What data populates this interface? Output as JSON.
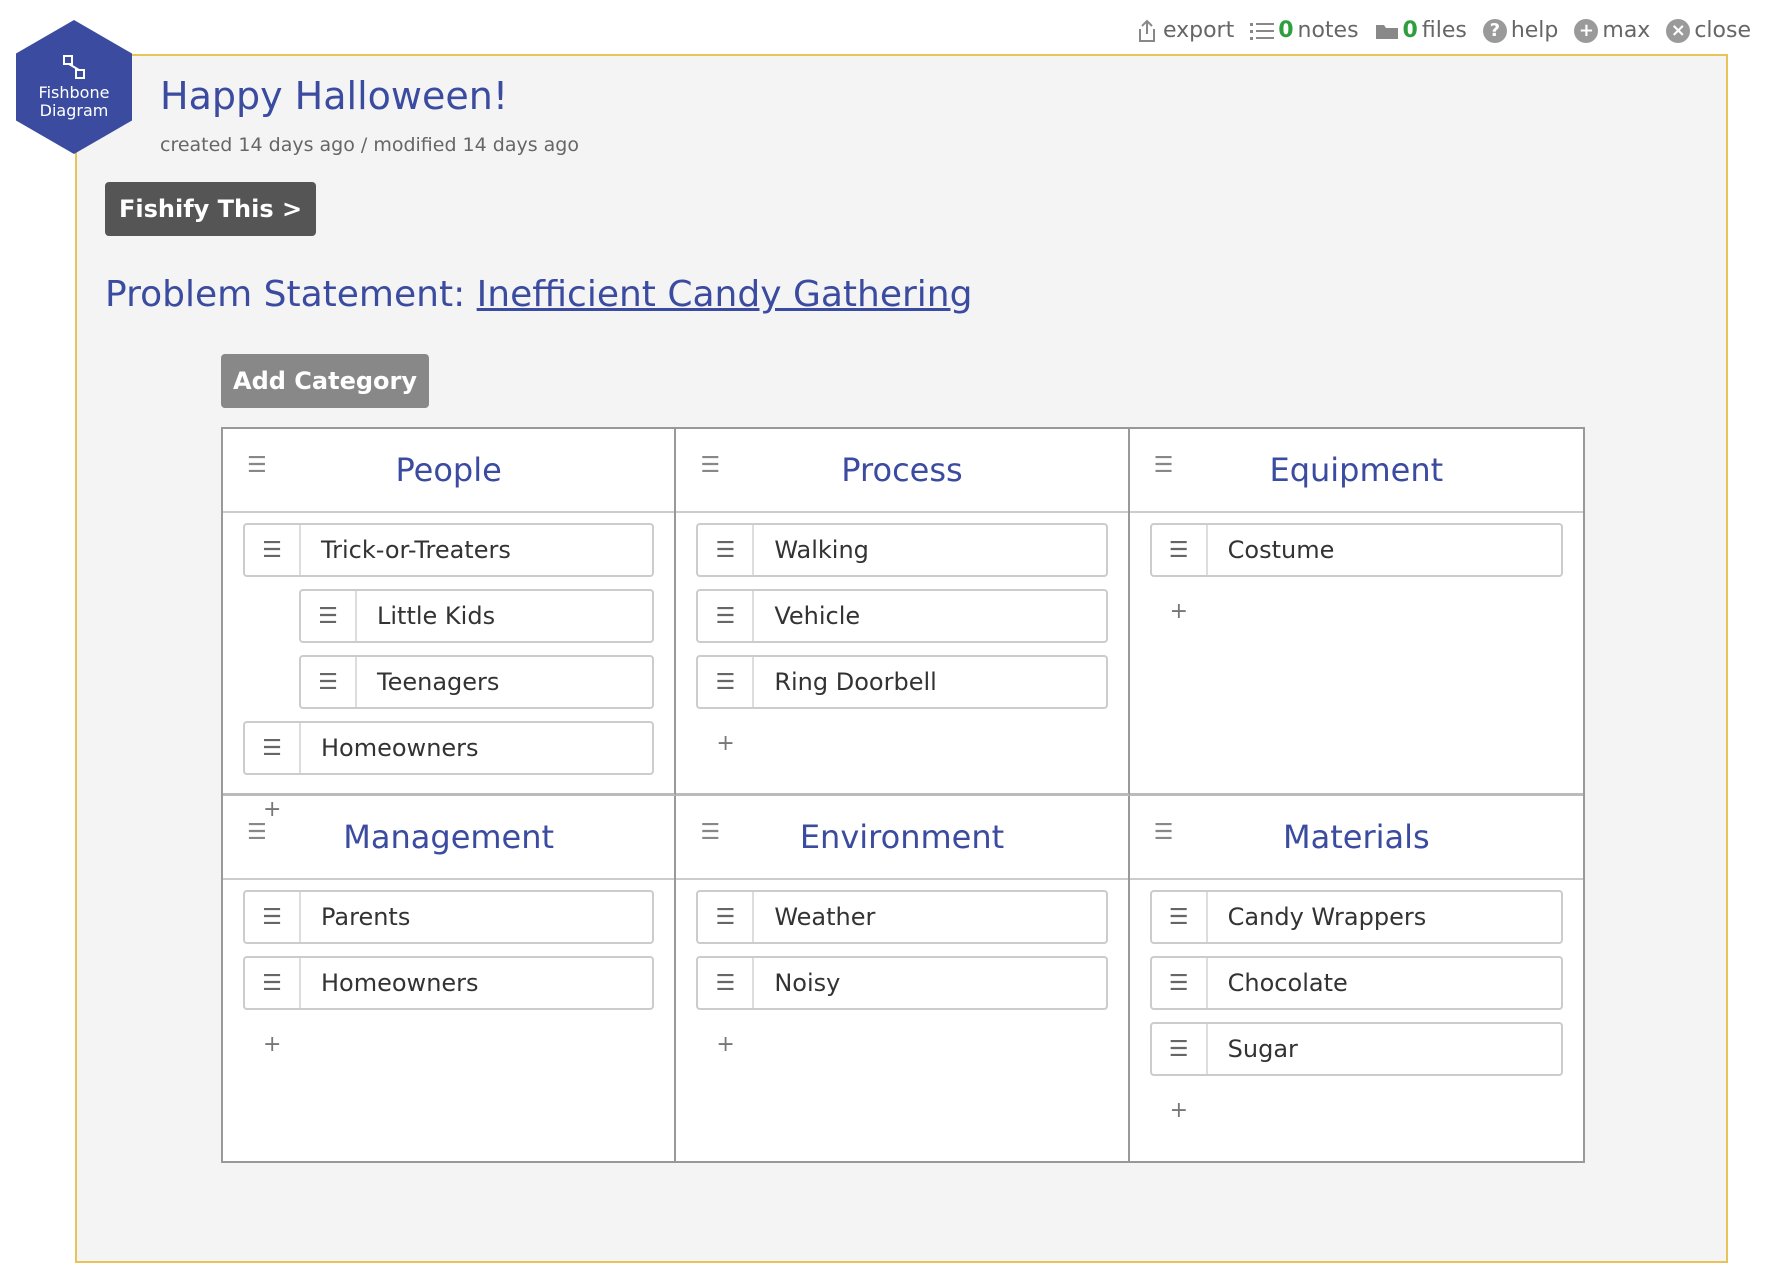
{
  "toolbar": {
    "export": "export",
    "notes_count": "0",
    "notes": "notes",
    "files_count": "0",
    "files": "files",
    "help": "help",
    "max": "max",
    "close": "close"
  },
  "badge": {
    "line1": "Fishbone",
    "line2": "Diagram"
  },
  "doc": {
    "title": "Happy Halloween!",
    "meta": "created 14 days ago / modified 14 days ago"
  },
  "fishify_label": "Fishify This >",
  "problem": {
    "prefix": "Problem Statement: ",
    "value": "Inefficient Candy Gathering"
  },
  "add_category_label": "Add Category",
  "categories": [
    {
      "name": "People",
      "items": [
        {
          "label": "Trick-or-Treaters",
          "indent": false
        },
        {
          "label": "Little Kids",
          "indent": true
        },
        {
          "label": "Teenagers",
          "indent": true
        },
        {
          "label": "Homeowners",
          "indent": false
        }
      ]
    },
    {
      "name": "Process",
      "items": [
        {
          "label": "Walking",
          "indent": false
        },
        {
          "label": "Vehicle",
          "indent": false
        },
        {
          "label": "Ring Doorbell",
          "indent": false
        }
      ]
    },
    {
      "name": "Equipment",
      "items": [
        {
          "label": "Costume",
          "indent": false
        }
      ]
    },
    {
      "name": "Management",
      "items": [
        {
          "label": "Parents",
          "indent": false
        },
        {
          "label": "Homeowners",
          "indent": false
        }
      ]
    },
    {
      "name": "Environment",
      "items": [
        {
          "label": "Weather",
          "indent": false
        },
        {
          "label": "Noisy",
          "indent": false
        }
      ]
    },
    {
      "name": "Materials",
      "items": [
        {
          "label": "Candy Wrappers",
          "indent": false
        },
        {
          "label": "Chocolate",
          "indent": false
        },
        {
          "label": "Sugar",
          "indent": false
        }
      ]
    }
  ],
  "add_item_symbol": "+",
  "drag_symbol": "☰",
  "colors": {
    "accent": "#3a4ba0",
    "frame_border": "#e8c35a",
    "count_green": "#2e9e3e"
  }
}
